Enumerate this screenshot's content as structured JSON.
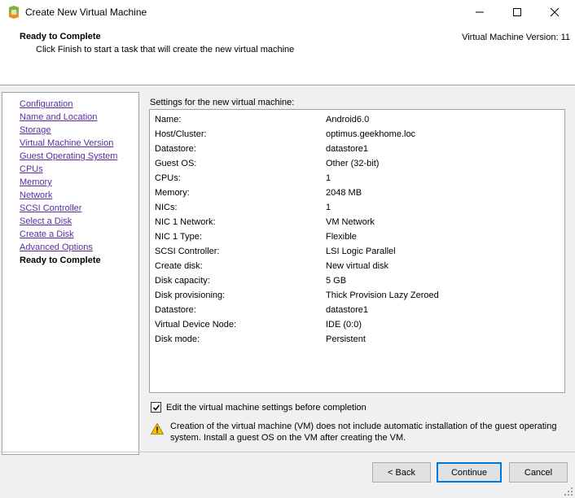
{
  "window": {
    "title": "Create New Virtual Machine",
    "icon": "vsphere-logo-icon",
    "controls": [
      "minimize-icon",
      "maximize-icon",
      "close-icon"
    ]
  },
  "header": {
    "title": "Ready to Complete",
    "subtitle": "Click Finish to start a task that will create the new virtual machine",
    "version": "Virtual Machine Version: 11"
  },
  "nav": {
    "items": [
      {
        "label": "Configuration"
      },
      {
        "label": "Name and Location"
      },
      {
        "label": "Storage"
      },
      {
        "label": "Virtual Machine Version"
      },
      {
        "label": "Guest Operating System"
      },
      {
        "label": "CPUs"
      },
      {
        "label": "Memory"
      },
      {
        "label": "Network"
      },
      {
        "label": "SCSI Controller"
      },
      {
        "label": "Select a Disk"
      },
      {
        "label": "Create a Disk"
      },
      {
        "label": "Advanced Options"
      },
      {
        "label": "Ready to Complete"
      }
    ],
    "current_index": 12
  },
  "settings": {
    "label": "Settings for the new virtual machine:",
    "rows": [
      {
        "name": "Name:",
        "value": "Android6.0"
      },
      {
        "name": "Host/Cluster:",
        "value": "optimus.geekhome.loc"
      },
      {
        "name": "Datastore:",
        "value": "datastore1"
      },
      {
        "name": "Guest OS:",
        "value": "Other (32-bit)"
      },
      {
        "name": "CPUs:",
        "value": "1"
      },
      {
        "name": "Memory:",
        "value": "2048 MB"
      },
      {
        "name": "NICs:",
        "value": "1"
      },
      {
        "name": "NIC 1 Network:",
        "value": "VM Network"
      },
      {
        "name": "NIC 1 Type:",
        "value": "Flexible"
      },
      {
        "name": "SCSI Controller:",
        "value": "LSI Logic Parallel"
      },
      {
        "name": "Create disk:",
        "value": "New virtual disk"
      },
      {
        "name": "Disk capacity:",
        "value": "5 GB"
      },
      {
        "name": "Disk provisioning:",
        "value": "Thick Provision Lazy Zeroed"
      },
      {
        "name": "Datastore:",
        "value": "datastore1"
      },
      {
        "name": "Virtual Device Node:",
        "value": "IDE (0:0)"
      },
      {
        "name": "Disk mode:",
        "value": "Persistent"
      }
    ]
  },
  "edit_checkbox": {
    "label": "Edit the virtual machine settings before completion",
    "checked": true
  },
  "warning": {
    "icon": "warning-icon",
    "text": "Creation of the virtual machine (VM) does not include automatic installation of the guest operating system. Install a guest OS on the VM after creating the VM."
  },
  "buttons": {
    "back": "< Back",
    "continue": "Continue",
    "cancel": "Cancel"
  },
  "colors": {
    "link": "#5a2ca0",
    "panel": "#f0f0f0",
    "focus": "#0078d7",
    "warning": "#f5c400"
  }
}
